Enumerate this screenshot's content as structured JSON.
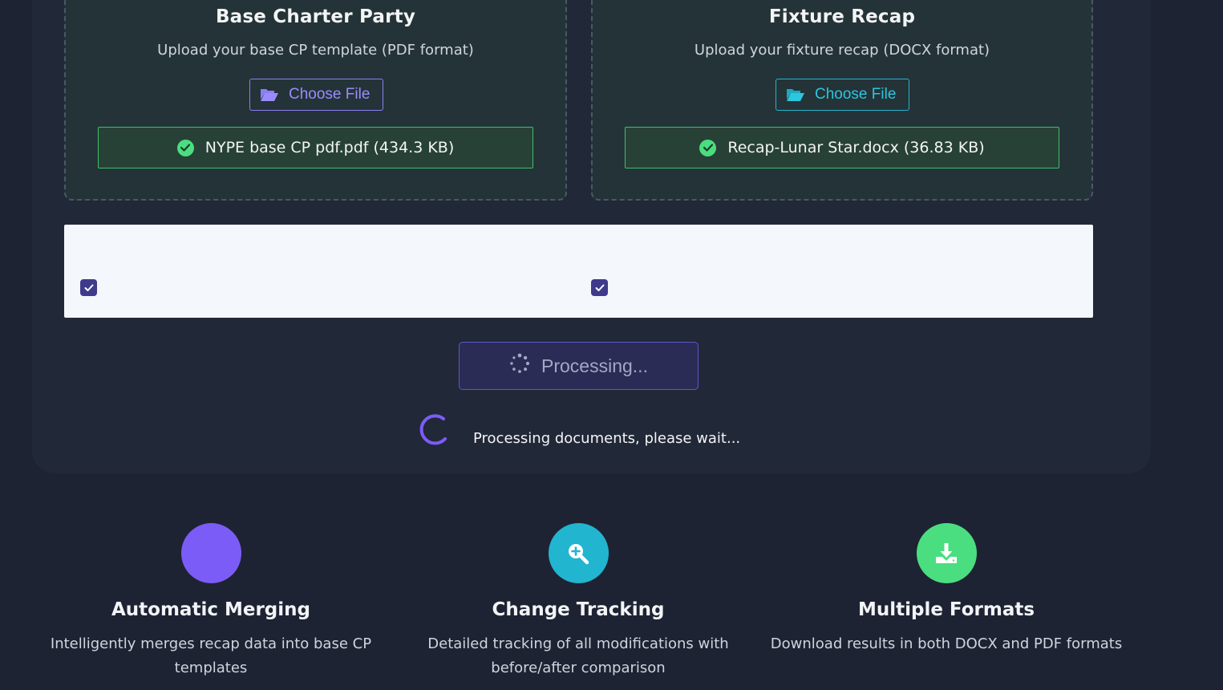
{
  "base_cp": {
    "title": "Base Charter Party",
    "description": "Upload your base CP template (PDF format)",
    "button_label": "Choose File",
    "button_icon": "folder-open-icon",
    "accent": "#8b7ff5",
    "file_status": "NYPE base CP pdf.pdf (434.3 KB)"
  },
  "fixture_recap": {
    "title": "Fixture Recap",
    "description": "Upload your fixture recap (DOCX format)",
    "button_label": "Choose File",
    "button_icon": "folder-open-icon",
    "accent": "#22b5cf",
    "file_status": "Recap-Lunar Star.docx (36.83 KB)"
  },
  "options": {
    "checkbox_1_checked": true,
    "checkbox_2_checked": true
  },
  "process": {
    "button_label": "Processing...",
    "loading_text": "Processing documents, please wait..."
  },
  "features": [
    {
      "title": "Automatic Merging",
      "description": "Intelligently merges recap data into base CP templates",
      "icon": "merge-icon",
      "color": "#7c5cf6"
    },
    {
      "title": "Change Tracking",
      "description": "Detailed tracking of all modifications with before/after comparison",
      "icon": "search-plus-icon",
      "color": "#22b5cf"
    },
    {
      "title": "Multiple Formats",
      "description": "Download results in both DOCX and PDF formats",
      "icon": "download-icon",
      "color": "#4ade80"
    }
  ],
  "colors": {
    "background": "#1d2333",
    "success": "#4ade80",
    "checkbox": "#3f3a8c"
  }
}
